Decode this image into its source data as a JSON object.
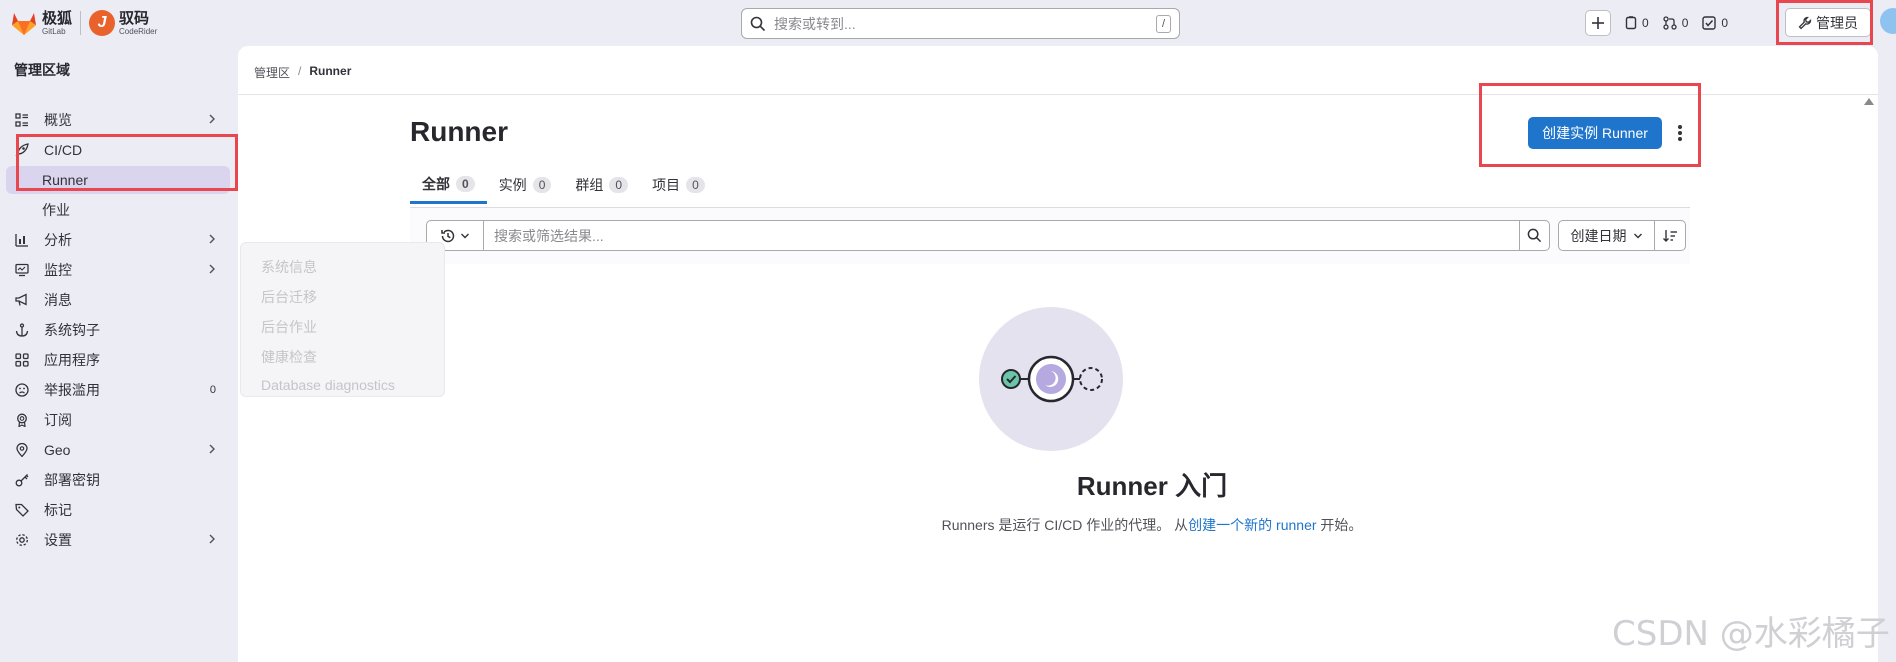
{
  "brand": {
    "name_cn": "极狐",
    "name_en": "GitLab",
    "partner_cn": "驭码",
    "partner_en": "CodeRider"
  },
  "topbar": {
    "search_placeholder": "搜索或转到...",
    "search_shortcut": "/",
    "issues_count": "0",
    "merge_requests_count": "0",
    "todos_count": "0",
    "admin_label": "管理员"
  },
  "sidebar": {
    "title": "管理区域",
    "items": [
      {
        "label": "概览"
      },
      {
        "label": "CI/CD"
      },
      {
        "label": "Runner"
      },
      {
        "label": "作业"
      },
      {
        "label": "分析"
      },
      {
        "label": "监控"
      },
      {
        "label": "消息"
      },
      {
        "label": "系统钩子"
      },
      {
        "label": "应用程序"
      },
      {
        "label": "举报滥用",
        "count": "0"
      },
      {
        "label": "订阅"
      },
      {
        "label": "Geo"
      },
      {
        "label": "部署密钥"
      },
      {
        "label": "标记"
      },
      {
        "label": "设置"
      }
    ],
    "flyout": [
      "系统信息",
      "后台迁移",
      "后台作业",
      "健康检查",
      "Database diagnostics"
    ]
  },
  "breadcrumb": {
    "root": "管理区",
    "current": "Runner"
  },
  "page": {
    "title": "Runner",
    "create_button": "创建实例 Runner",
    "tabs": [
      {
        "label": "全部",
        "count": "0"
      },
      {
        "label": "实例",
        "count": "0"
      },
      {
        "label": "群组",
        "count": "0"
      },
      {
        "label": "项目",
        "count": "0"
      }
    ],
    "filter_placeholder": "搜索或筛选结果...",
    "sort_label": "创建日期",
    "empty_title": "Runner 入门",
    "empty_desc_prefix": "Runners 是运行 CI/CD 作业的代理。 从",
    "empty_desc_link": "创建一个新的 runner",
    "empty_desc_suffix": " 开始。"
  },
  "watermark": "CSDN @水彩橘子",
  "colors": {
    "accent": "#1f75cb",
    "highlight": "#e8474f",
    "active_nav": "#dad4ee",
    "brand_orange": "#e9622c"
  }
}
